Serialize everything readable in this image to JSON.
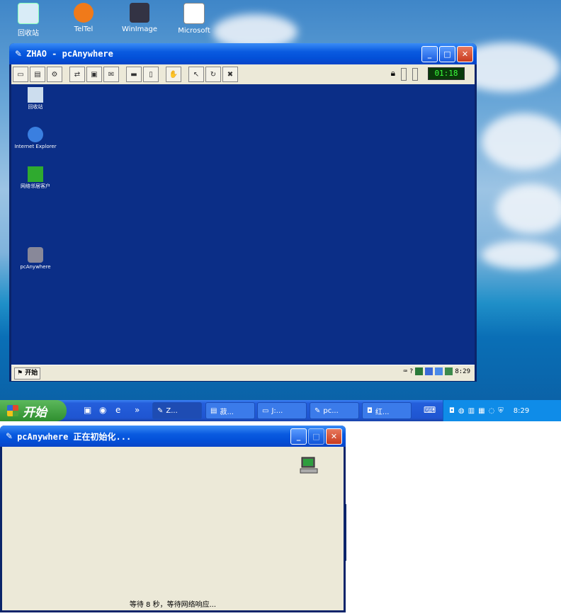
{
  "desktop": {
    "icons": [
      {
        "label": "回收站",
        "icon": "recycle-bin-icon"
      },
      {
        "label": "TelTel",
        "icon": "teltel-icon"
      },
      {
        "label": "WinImage",
        "icon": "winimage-icon"
      },
      {
        "label": "Microsoft",
        "icon": "microsoft-doc-icon"
      }
    ]
  },
  "main_window": {
    "title": "ZHAO - pcAnywhere",
    "timer": "01:18",
    "remote_icons": [
      {
        "label": "回收站",
        "icon": "recycle-bin-icon"
      },
      {
        "label": "Internet Explorer",
        "icon": "ie-icon"
      },
      {
        "label": "网络邻居客户",
        "icon": "network-icon"
      },
      {
        "label": "pcAnywhere",
        "icon": "pcanywhere-icon"
      }
    ],
    "remote_start": "开始",
    "remote_clock": "8:29"
  },
  "taskbar": {
    "start_label": "开始",
    "tasks": [
      {
        "label": "Z...",
        "icon": "pcanywhere-icon"
      },
      {
        "label": "菽...",
        "icon": "doc-icon"
      },
      {
        "label": "J:...",
        "icon": "folder-icon"
      },
      {
        "label": "pc...",
        "icon": "pcanywhere-icon"
      },
      {
        "label": "红...",
        "icon": "camera-icon"
      }
    ],
    "clock": "8:29"
  },
  "init_dialog": {
    "title": "pcAnywhere 正在初始化...",
    "message": "等待 8 秒，等待网络响应..."
  },
  "colors": {
    "xp_blue": "#0a5be0",
    "remote_desktop": "#0b2e87",
    "dialog_face": "#ece9d8"
  }
}
